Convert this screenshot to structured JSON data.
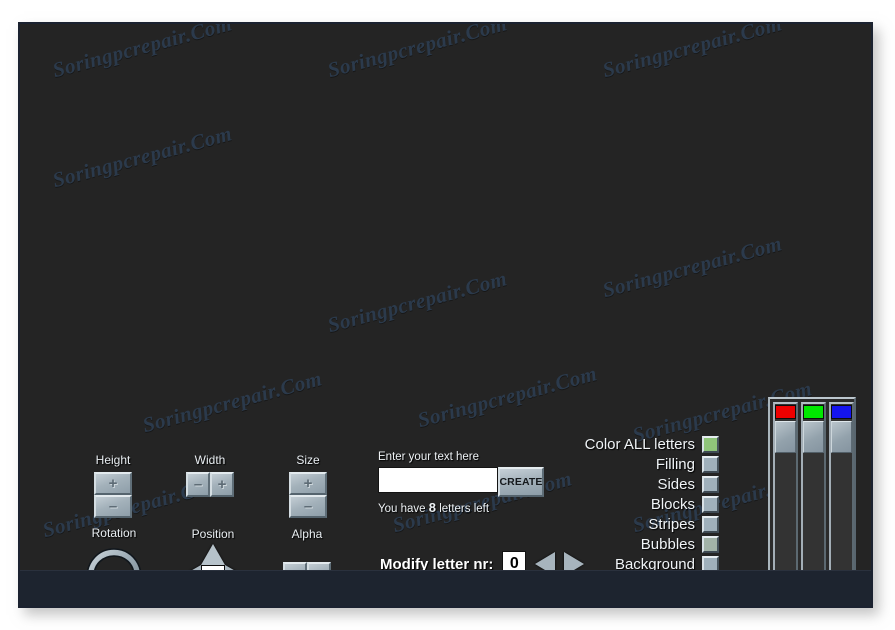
{
  "app": {
    "watermark_text": "Soringpcrepair.Com",
    "background_color": "#242424",
    "frame_color": "#1b2230",
    "rail_color": "#1d242f"
  },
  "transform_controls": [
    {
      "name": "height",
      "label": "Height",
      "orientation": "vertical",
      "buttons": [
        "+",
        "–"
      ]
    },
    {
      "name": "width",
      "label": "Width",
      "orientation": "horizontal",
      "buttons": [
        "–",
        "+"
      ]
    },
    {
      "name": "size",
      "label": "Size",
      "orientation": "vertical",
      "buttons": [
        "+",
        "–"
      ]
    }
  ],
  "motion_controls": [
    {
      "name": "rotation",
      "label": "Rotation",
      "type": "dial"
    },
    {
      "name": "position",
      "label": "Position",
      "type": "dpad"
    },
    {
      "name": "alpha",
      "label": "Alpha",
      "type": "horizontal",
      "buttons": [
        "–",
        "+"
      ]
    }
  ],
  "text_entry": {
    "label": "Enter your text here",
    "input_value": "",
    "input_placeholder": "",
    "create_label": "CREATE",
    "letters_prefix": "You have",
    "letters_count": "8",
    "letters_suffix": "letters left"
  },
  "modify": {
    "label": "Modify letter nr:",
    "value": "0",
    "prev_icon": "triangle-left-icon",
    "next_icon": "triangle-right-icon"
  },
  "color_targets": [
    {
      "label": "Color ALL letters",
      "color": "#8fc47a"
    },
    {
      "label": "Filling",
      "color": "#9fb0bb"
    },
    {
      "label": "Sides",
      "color": "#9fb0bb"
    },
    {
      "label": "Blocks",
      "color": "#9fb0bb"
    },
    {
      "label": "Stripes",
      "color": "#9fb0bb"
    },
    {
      "label": "Bubbles",
      "color": "#a2b3a8"
    },
    {
      "label": "Background",
      "color": "#9fb0bb"
    }
  ],
  "rgb_panel": {
    "channels": [
      {
        "name": "red",
        "chip_color": "#ee0000",
        "knob_position_pct": 0
      },
      {
        "name": "green",
        "chip_color": "#00e800",
        "knob_position_pct": 0
      },
      {
        "name": "blue",
        "chip_color": "#1414ee",
        "knob_position_pct": 0
      }
    ],
    "preview_color": "#ffffff"
  }
}
